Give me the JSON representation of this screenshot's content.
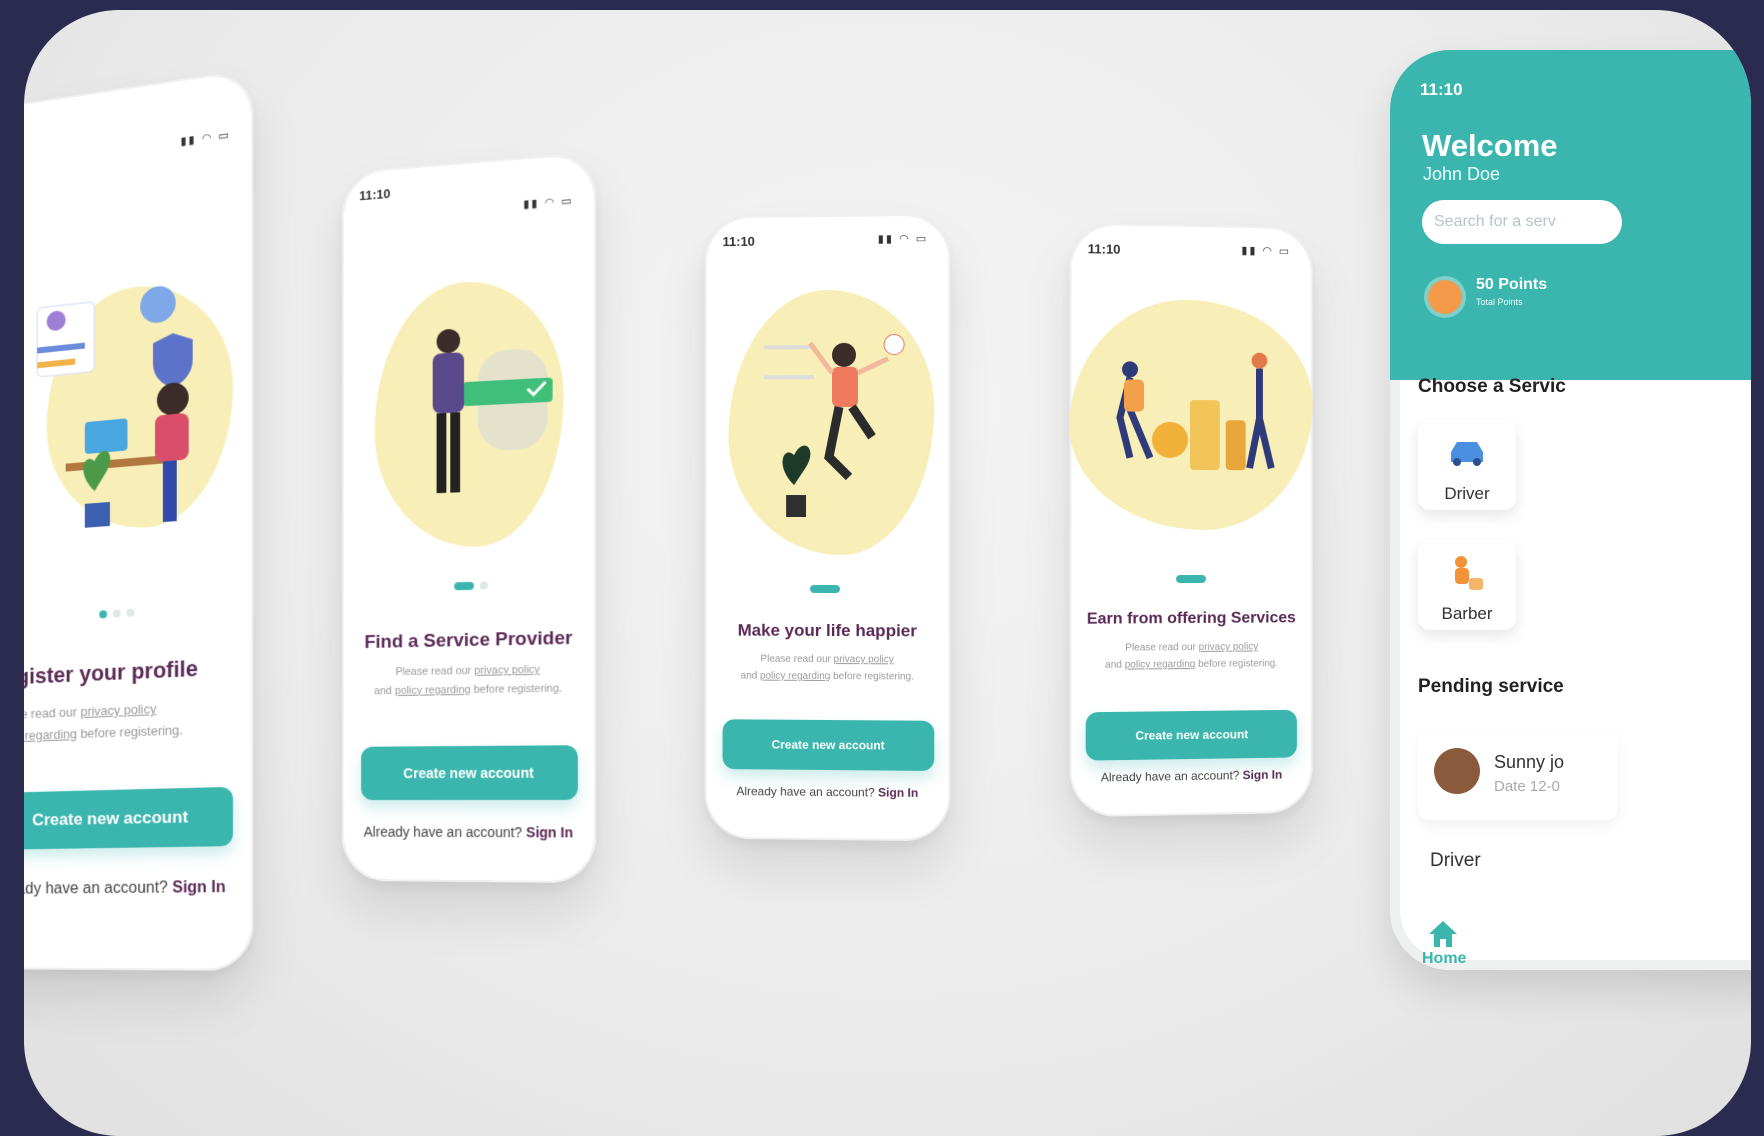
{
  "screens": [
    {
      "title": "Register your profile",
      "desc_pre": "Please read our ",
      "desc_link1": "privacy policy",
      "desc_mid": "and ",
      "desc_link2": "policy regarding",
      "desc_post": " before registering.",
      "button": "Create new account",
      "signin_pre": "Already have an account? ",
      "signin_link": "Sign In"
    },
    {
      "time": "11:10",
      "title": "Find a Service Provider",
      "desc_pre": "Please read our ",
      "desc_link1": "privacy policy",
      "desc_mid": "and ",
      "desc_link2": "policy regarding",
      "desc_post": " before registering.",
      "button": "Create new account",
      "signin_pre": "Already have an account? ",
      "signin_link": "Sign In"
    },
    {
      "time": "11:10",
      "title": "Make your life happier",
      "desc_pre": "Please read our ",
      "desc_link1": "privacy policy",
      "desc_mid": "and ",
      "desc_link2": "policy regarding",
      "desc_post": " before registering.",
      "button": "Create new account",
      "signin_pre": "Already have an account? ",
      "signin_link": "Sign In"
    },
    {
      "time": "11:10",
      "title": "Earn from offering Services",
      "desc_pre": "Please read our ",
      "desc_link1": "privacy policy",
      "desc_mid": "and ",
      "desc_link2": "policy regarding",
      "desc_post": " before registering.",
      "button": "Create new account",
      "signin_pre": "Already have an account? ",
      "signin_link": "Sign In"
    }
  ],
  "home": {
    "time": "11:10",
    "welcome": "Welcome",
    "user": "John Doe",
    "search_placeholder": "Search for a serv",
    "points": "50 Points",
    "points_sub": "Total Points",
    "choose_title": "Choose a Servic",
    "services": [
      "Driver",
      "Barber"
    ],
    "pending_title": "Pending service",
    "pending_name": "Sunny jo",
    "pending_date": "Date 12-0",
    "pending_type": "Driver",
    "nav_home": "Home"
  },
  "colors": {
    "accent": "#3bb6ae",
    "title": "#5a2a56",
    "blob": "#f8efb8",
    "frame": "#2b2a4f"
  }
}
